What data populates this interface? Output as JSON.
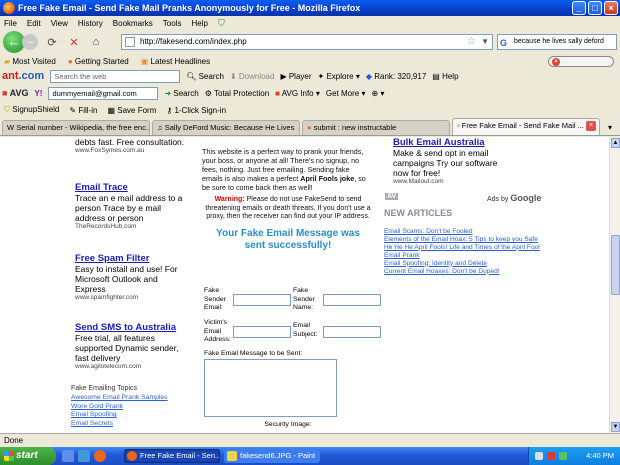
{
  "window": {
    "title": "Free Fake Email - Send Fake Mail Pranks Anonymously for Free - Mozilla Firefox"
  },
  "menu": [
    "File",
    "Edit",
    "View",
    "History",
    "Bookmarks",
    "Tools",
    "Help"
  ],
  "address": {
    "url": "http://fakesend.com/index.php",
    "search_value": "because he lives sally deford"
  },
  "bookmarks": [
    "Most Visited",
    "Getting Started",
    "Latest Headlines"
  ],
  "ant_toolbar": {
    "search_placeholder": "Search the web",
    "search": "Search",
    "download": "Download",
    "player": "Player",
    "explore": "Explore",
    "rank": "Rank: 320,917",
    "help": "Help"
  },
  "avg_toolbar": {
    "logo": "AVG",
    "email": "dummyemail@gmail.com",
    "search": "Search",
    "total_protection": "Total Protection",
    "avg_info": "AVG Info",
    "get_more": "Get More"
  },
  "signup_toolbar": [
    "SignupShield",
    "Fill-in",
    "Save Form",
    "1-Click Sign-in"
  ],
  "tabs": [
    {
      "label": "Serial number - Wikipedia, the free enc..."
    },
    {
      "label": "Sally DeFord Music: Because He Lives"
    },
    {
      "label": "submit : new instructable"
    },
    {
      "label": "Free Fake Email - Send Fake Mail ..."
    }
  ],
  "left_ads": [
    {
      "title": "",
      "body": "debts fast. Free consultation.",
      "url": "www.FoxSymes.com.au"
    },
    {
      "title": "Email Trace",
      "body": "Trace an e mail address to a person Trace by e mail address or person",
      "url": "TheRecordsHub.com"
    },
    {
      "title": "Free Spam Filter",
      "body": "Easy to install and use! For Microsoft Outlook and Express",
      "url": "www.spamfighter.com"
    },
    {
      "title": "Send SMS to Australia",
      "body": "Free trial, all features supported Dynamic sender, fast delivery",
      "url": "www.agilotelecom.com"
    }
  ],
  "fake_topics": {
    "heading": "Fake Emailing Topics",
    "links": [
      "Awesome Email Prank Samples",
      "Wore Gold Prank",
      "Email Spoofing",
      "Email Secrets"
    ]
  },
  "main": {
    "lead_a": "This website is a perfect way to prank your friends, your boss, or anyone at all! There's no signup, no fees, nothing. Just free emailing. Sending fake emails is also makes a perfect ",
    "lead_bold": "April Fools joke",
    "lead_b": ", so be sure to come back then as well!",
    "warning_label": "Warning:",
    "warning_text": " Please do not use FakeSend to send threatening emails or death threats. If you don't use a proxy, then the receiver can find out your IP address.",
    "success": "Your Fake Email Message was sent successfully!",
    "sender_email": "Fake Sender Email:",
    "sender_name": "Fake Sender Name:",
    "victim_email": "Victim's Email Address:",
    "email_subject": "Email Subject:",
    "message_label": "Fake Email Message to be Sent:",
    "security_image": "Security Image:"
  },
  "right": {
    "ad_title": "Bulk Email Australia",
    "ad_body": "Make & send opt in email campaigns Try our software now for free!",
    "ad_url": "www.Mailout.com",
    "ads_by": "Ads by",
    "google": "Google",
    "new_articles": "NEW ARTICLES",
    "articles": [
      "Email Scams: Don't be Fooled",
      "Elements of the Email Hoax: 5 Tips to keep you Safe",
      "He He He April Fools! Life and Times of the April Fool",
      "Email Prank",
      "Email Spoofing: Identity and Delete",
      "Current Email Hoaxes: Don't be Duped!"
    ]
  },
  "status": {
    "text": "Done"
  },
  "taskbar": {
    "start": "start",
    "tasks": [
      "Free Fake Email - Sen...",
      "fakesend6.JPG - Paint"
    ],
    "clock": "4:40 PM"
  }
}
